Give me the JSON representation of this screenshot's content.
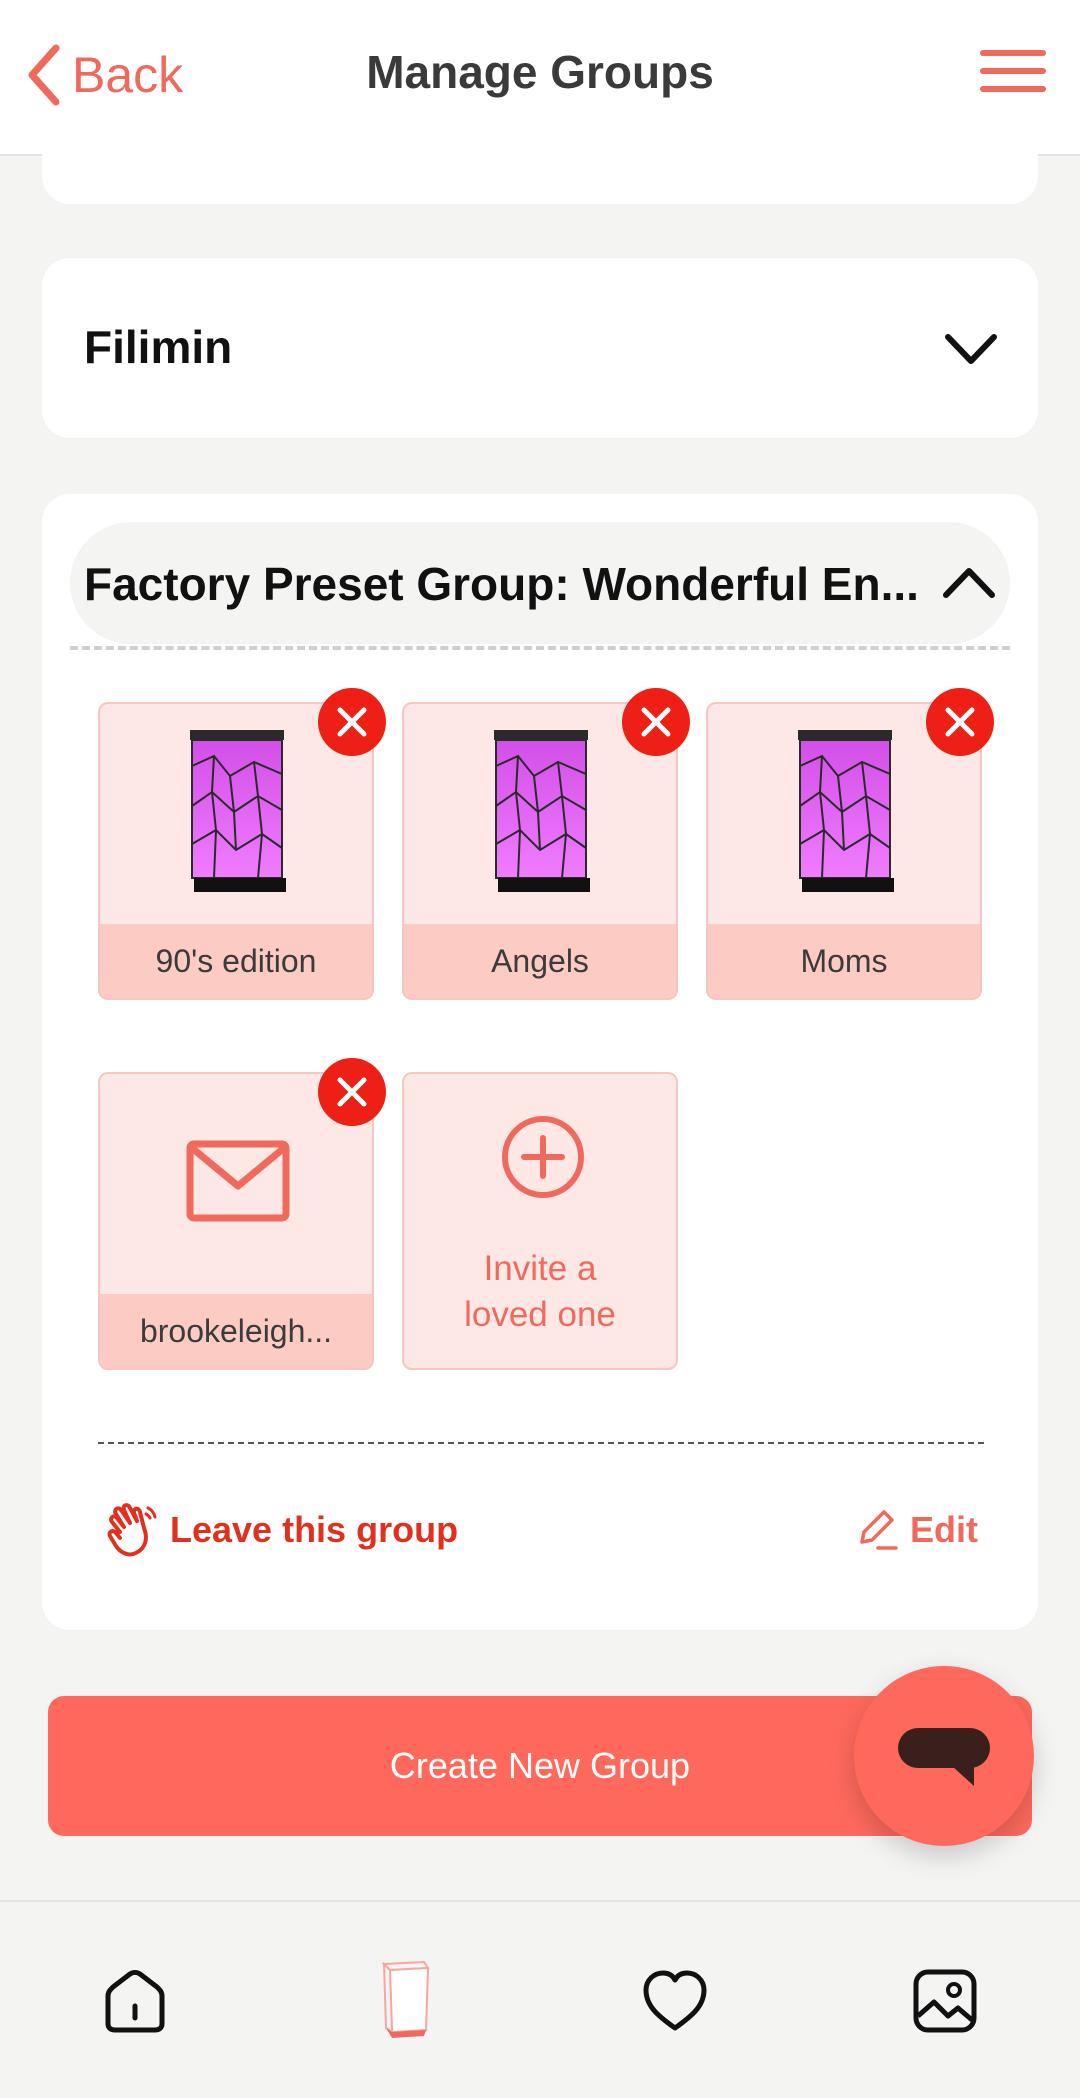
{
  "header": {
    "back_label": "Back",
    "title": "Manage Groups"
  },
  "groups": {
    "collapsed_group": {
      "name": "Filimin"
    },
    "expanded_group": {
      "name": "Factory Preset Group: Wonderful En...",
      "members": [
        {
          "label": "90's edition",
          "icon": "lamp-icon"
        },
        {
          "label": "Angels",
          "icon": "lamp-icon"
        },
        {
          "label": "Moms",
          "icon": "lamp-icon"
        },
        {
          "label": "brookeleigh...",
          "icon": "mail-icon"
        }
      ],
      "invite_label_line1": "Invite a",
      "invite_label_line2": "loved one",
      "leave_label": "Leave this group",
      "edit_label": "Edit"
    }
  },
  "create_button_label": "Create New Group",
  "bottom_nav": [
    "home-icon",
    "lamp-icon",
    "heart-icon",
    "gallery-icon"
  ],
  "colors": {
    "accent": "#ef6a5c",
    "button": "#fe695c",
    "remove": "#ee1f14",
    "tile_bg": "#fde8e6",
    "tile_label_bg": "#fccbc4",
    "leave_text": "#e2301f"
  }
}
